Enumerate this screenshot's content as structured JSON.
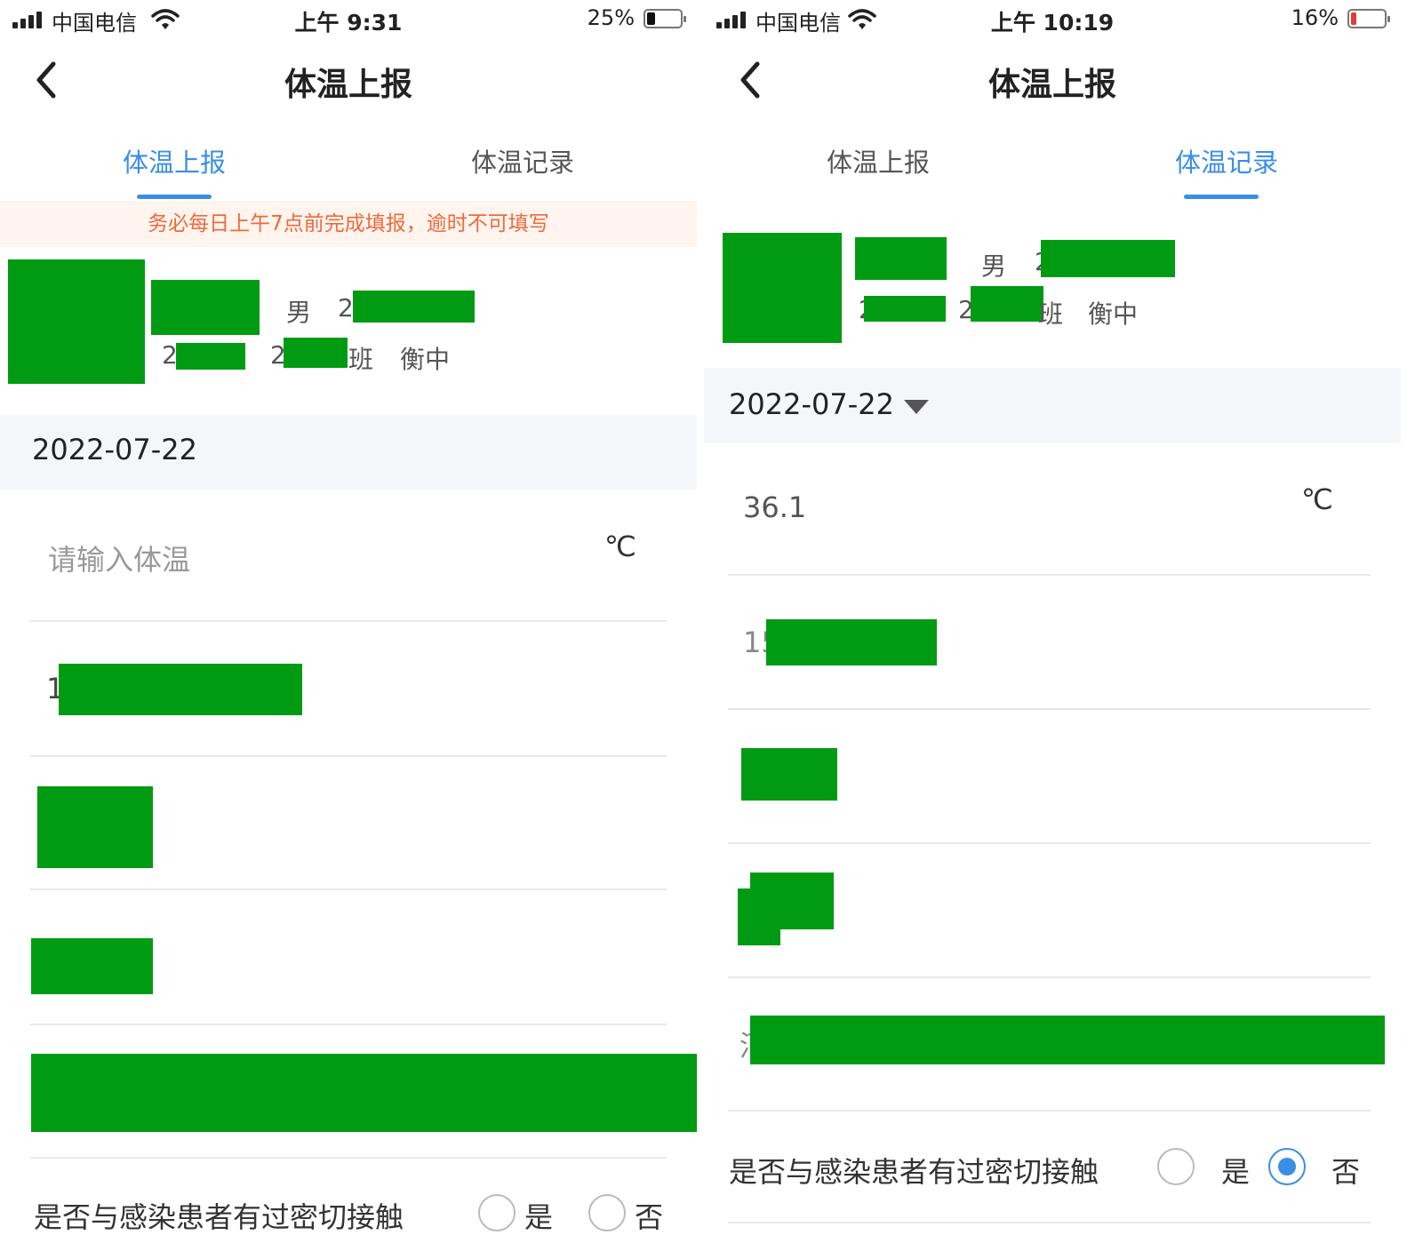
{
  "left": {
    "status": {
      "carrier": "中国电信",
      "time": "上午 9:31",
      "battery": "25%"
    },
    "nav": {
      "title": "体温上报"
    },
    "tabs": [
      {
        "label": "体温上报",
        "active": true
      },
      {
        "label": "体温记录",
        "active": false
      }
    ],
    "notice": "务必每日上午7点前完成填报，逾时不可填写",
    "profile": {
      "gender": "男",
      "partial_id": "2",
      "partial_grade": "2",
      "partial_class": "2",
      "class_suffix": "班",
      "school": "衡中"
    },
    "date": "2022-07-22",
    "temperature": {
      "placeholder": "请输入体温",
      "unit": "℃"
    },
    "phone_partial": "1",
    "contact": {
      "question": "是否与感染患者有过密切接触",
      "yes": "是",
      "no": "否",
      "selected": null
    }
  },
  "right": {
    "status": {
      "carrier": "中国电信",
      "time": "上午 10:19",
      "battery": "16%"
    },
    "nav": {
      "title": "体温上报"
    },
    "tabs": [
      {
        "label": "体温上报",
        "active": false
      },
      {
        "label": "体温记录",
        "active": true
      }
    ],
    "profile": {
      "gender": "男",
      "partial_id": "2",
      "partial_grade": "2",
      "partial_class": "2",
      "class_suffix": "班",
      "school": "衡中"
    },
    "date": "2022-07-22",
    "temperature": {
      "value": "36.1",
      "unit": "℃"
    },
    "phone_partial": "15",
    "address_partial": "河",
    "contact": {
      "question": "是否与感染患者有过密切接触",
      "yes": "是",
      "no": "否",
      "selected": "否"
    }
  },
  "colors": {
    "accent": "#3a8ee6",
    "notice_text": "#ee6a3c",
    "notice_bg": "#fff4ee",
    "battery_low": "#e53935"
  },
  "icons": [
    "signal-icon",
    "wifi-icon",
    "battery-icon",
    "back-chevron-icon",
    "caret-down-icon"
  ]
}
